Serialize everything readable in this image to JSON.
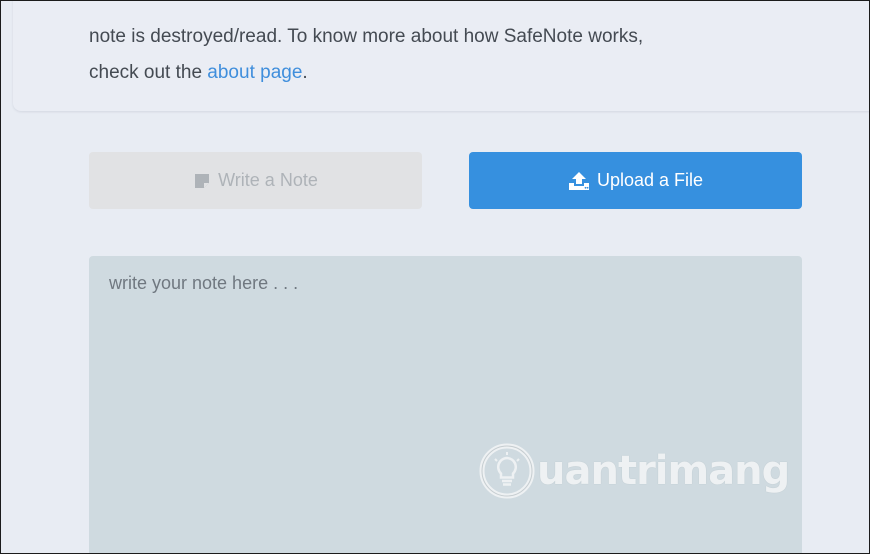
{
  "intro": {
    "line1": "note is destroyed/read. To know more about how SafeNote works,",
    "line2_prefix": "check out the ",
    "link_text": "about page",
    "line2_suffix": "."
  },
  "tabs": [
    {
      "label": "Write a Note",
      "icon": "note-icon",
      "active": false
    },
    {
      "label": "Upload a File",
      "icon": "upload-icon",
      "active": true
    }
  ],
  "note_input": {
    "placeholder": "write your note here . . ."
  },
  "watermark": {
    "text": "uantrimang",
    "logo": "lightbulb-logo"
  },
  "colors": {
    "page_bg": "#e8ecf3",
    "link": "#3f8edc",
    "active_tab": "#3690df",
    "inactive_tab": "#e1e2e4",
    "textarea_bg": "#cfdae0"
  }
}
